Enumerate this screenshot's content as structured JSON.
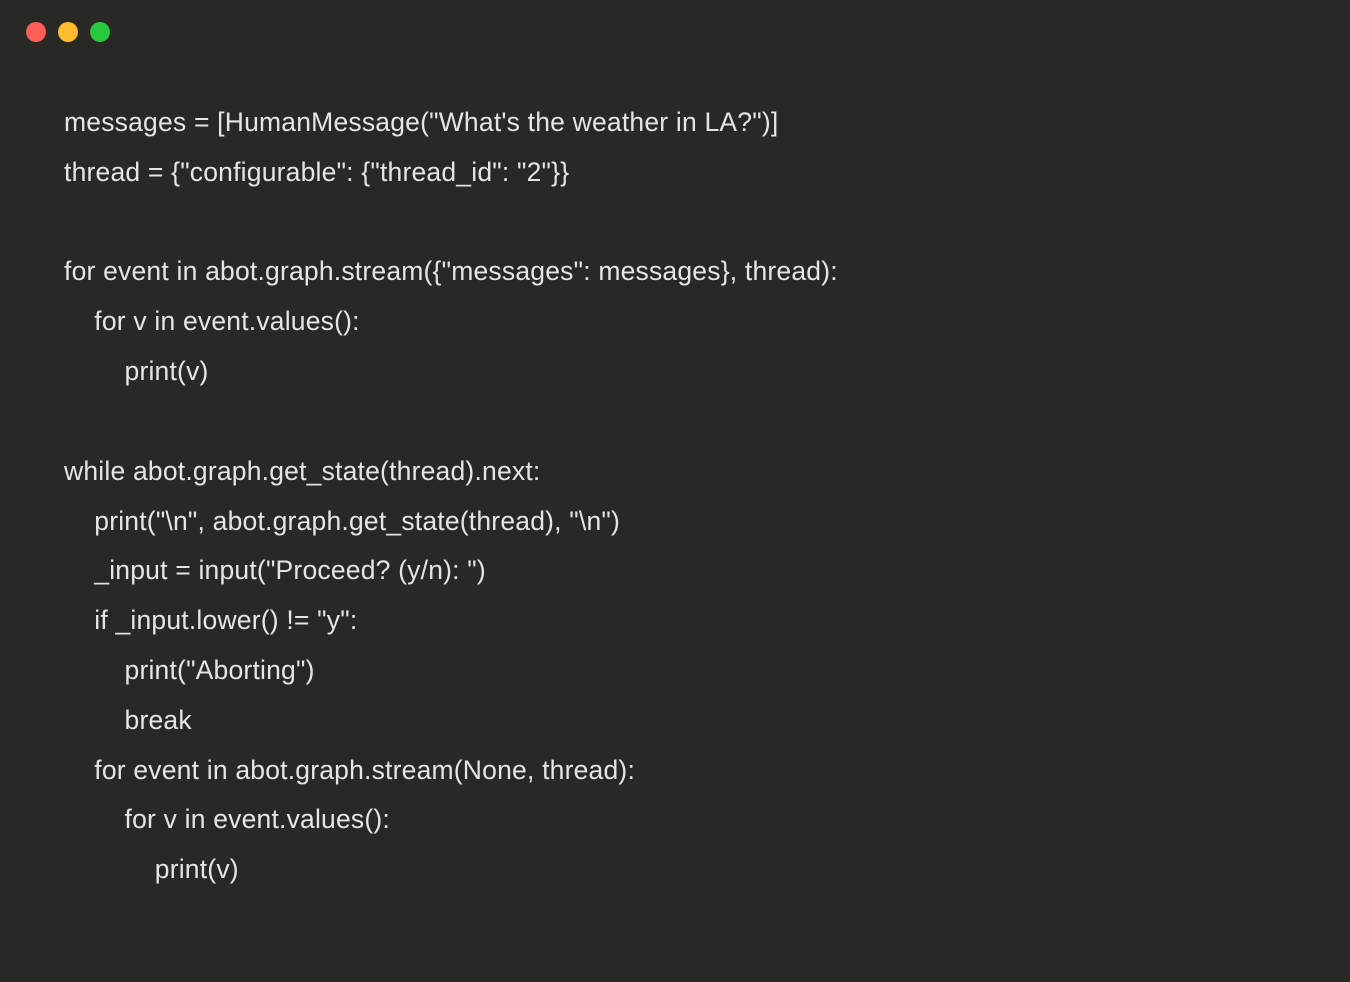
{
  "titlebar": {
    "dots": {
      "red": "#ff5f56",
      "yellow": "#ffbd2e",
      "green": "#27c93f"
    }
  },
  "code": {
    "lines": [
      "messages = [HumanMessage(\"What's the weather in LA?\")]",
      "thread = {\"configurable\": {\"thread_id\": \"2\"}}",
      "",
      "for event in abot.graph.stream({\"messages\": messages}, thread):",
      "    for v in event.values():",
      "        print(v)",
      "",
      "while abot.graph.get_state(thread).next:",
      "    print(\"\\n\", abot.graph.get_state(thread), \"\\n\")",
      "    _input = input(\"Proceed? (y/n): \")",
      "    if _input.lower() != \"y\":",
      "        print(\"Aborting\")",
      "        break",
      "    for event in abot.graph.stream(None, thread):",
      "        for v in event.values():",
      "            print(v)"
    ]
  }
}
